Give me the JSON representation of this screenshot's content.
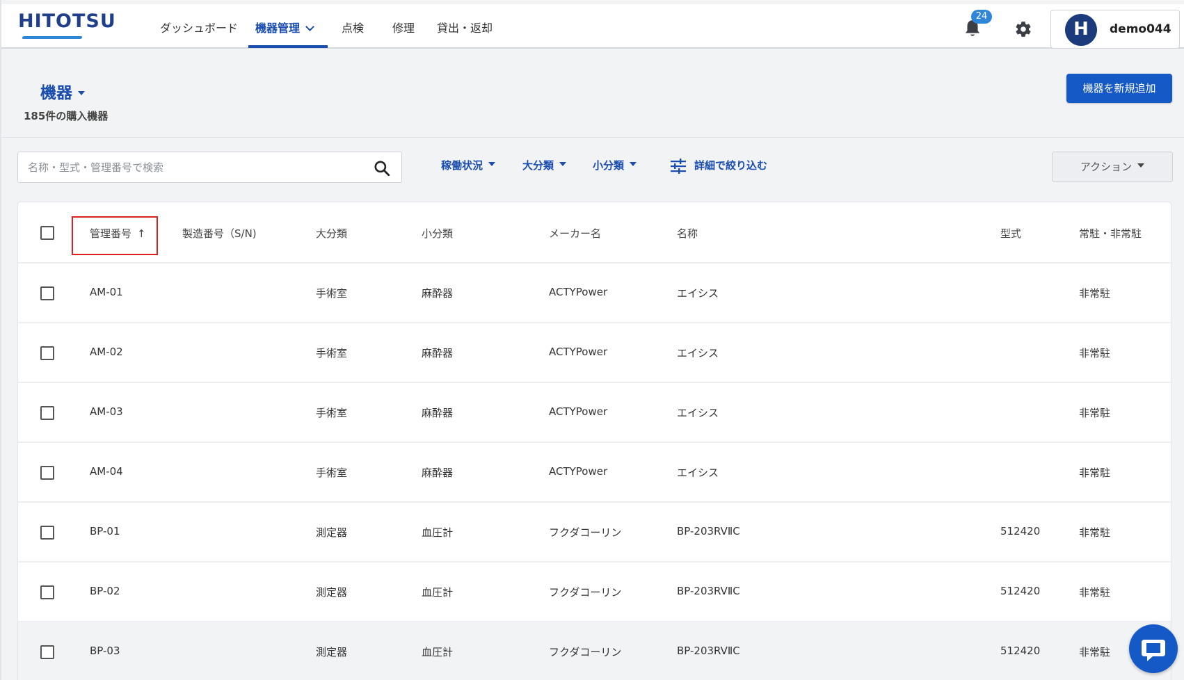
{
  "app": {
    "logo": "HITOTSU"
  },
  "nav": {
    "items": [
      {
        "label": "ダッシュボード"
      },
      {
        "label": "機器管理"
      },
      {
        "label": "点検"
      },
      {
        "label": "修理"
      },
      {
        "label": "貸出・返却"
      }
    ],
    "notifications_count": "24",
    "user": {
      "initial": "H",
      "name": "demo044"
    }
  },
  "page": {
    "title": "機器",
    "subtitle": "185件の購入機器",
    "add_button": "機器を新規追加"
  },
  "search": {
    "placeholder": "名称・型式・管理番号で検索"
  },
  "filters": {
    "status": "稼働状況",
    "major": "大分類",
    "minor": "小分類",
    "detail": "詳細で絞り込む",
    "action": "アクション"
  },
  "table": {
    "headers": {
      "mgmt_no": "管理番号",
      "serial": "製造番号（S/N)",
      "major": "大分類",
      "minor": "小分類",
      "maker": "メーカー名",
      "name": "名称",
      "model": "型式",
      "resident": "常駐・非常駐"
    },
    "rows": [
      {
        "mgmt_no": "AM-01",
        "serial": "",
        "major": "手術室",
        "minor": "麻酔器",
        "maker": "ACTYPower",
        "name": "エイシス",
        "model": "",
        "resident": "非常駐"
      },
      {
        "mgmt_no": "AM-02",
        "serial": "",
        "major": "手術室",
        "minor": "麻酔器",
        "maker": "ACTYPower",
        "name": "エイシス",
        "model": "",
        "resident": "非常駐"
      },
      {
        "mgmt_no": "AM-03",
        "serial": "",
        "major": "手術室",
        "minor": "麻酔器",
        "maker": "ACTYPower",
        "name": "エイシス",
        "model": "",
        "resident": "非常駐"
      },
      {
        "mgmt_no": "AM-04",
        "serial": "",
        "major": "手術室",
        "minor": "麻酔器",
        "maker": "ACTYPower",
        "name": "エイシス",
        "model": "",
        "resident": "非常駐"
      },
      {
        "mgmt_no": "BP-01",
        "serial": "",
        "major": "測定器",
        "minor": "血圧計",
        "maker": "フクダコーリン",
        "name": "BP-203RVⅡC",
        "model": "512420",
        "resident": "非常駐"
      },
      {
        "mgmt_no": "BP-02",
        "serial": "",
        "major": "測定器",
        "minor": "血圧計",
        "maker": "フクダコーリン",
        "name": "BP-203RVⅡC",
        "model": "512420",
        "resident": "非常駐"
      },
      {
        "mgmt_no": "BP-03",
        "serial": "",
        "major": "測定器",
        "minor": "血圧計",
        "maker": "フクダコーリン",
        "name": "BP-203RVⅡC",
        "model": "512420",
        "resident": "非常駐"
      }
    ]
  }
}
